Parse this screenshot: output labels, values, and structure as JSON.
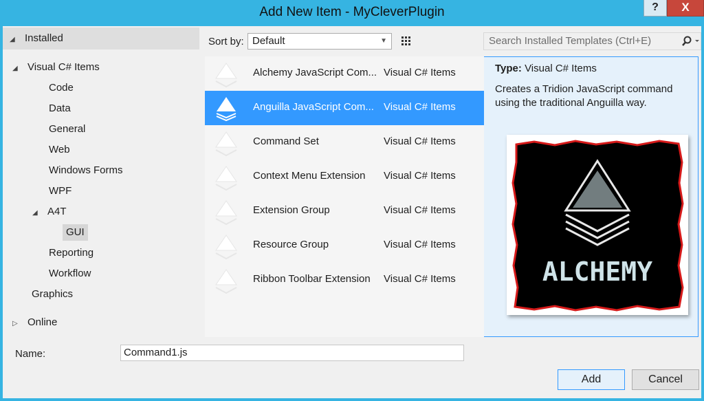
{
  "window": {
    "title": "Add New Item - MyCleverPlugin",
    "help_label": "?",
    "close_label": "X"
  },
  "tree": {
    "installed": "Installed",
    "visual_csharp": "Visual C# Items",
    "children": [
      "Code",
      "Data",
      "General",
      "Web",
      "Windows Forms",
      "WPF"
    ],
    "a4t": "A4T",
    "gui": "GUI",
    "reporting": "Reporting",
    "workflow": "Workflow",
    "graphics": "Graphics",
    "online": "Online"
  },
  "toolbar": {
    "sort_label": "Sort by:",
    "sort_value": "Default",
    "search_placeholder": "Search Installed Templates (Ctrl+E)"
  },
  "templates": [
    {
      "name": "Alchemy JavaScript Com...",
      "category": "Visual C# Items",
      "selected": false
    },
    {
      "name": "Anguilla JavaScript Com...",
      "category": "Visual C# Items",
      "selected": true
    },
    {
      "name": "Command Set",
      "category": "Visual C# Items",
      "selected": false
    },
    {
      "name": "Context Menu Extension",
      "category": "Visual C# Items",
      "selected": false
    },
    {
      "name": "Extension Group",
      "category": "Visual C# Items",
      "selected": false
    },
    {
      "name": "Resource Group",
      "category": "Visual C# Items",
      "selected": false
    },
    {
      "name": "Ribbon Toolbar Extension",
      "category": "Visual C# Items",
      "selected": false
    }
  ],
  "details": {
    "type_label": "Type:",
    "type_value": "Visual C# Items",
    "description": "Creates a Tridion JavaScript command using the traditional Anguilla way.",
    "preview_logo_text": "ALCHEMY"
  },
  "footer": {
    "name_label": "Name:",
    "name_value": "Command1.js",
    "add_label": "Add",
    "cancel_label": "Cancel"
  },
  "colors": {
    "accent": "#36b4e2",
    "selection": "#3399ff",
    "close_button": "#c7473b"
  }
}
